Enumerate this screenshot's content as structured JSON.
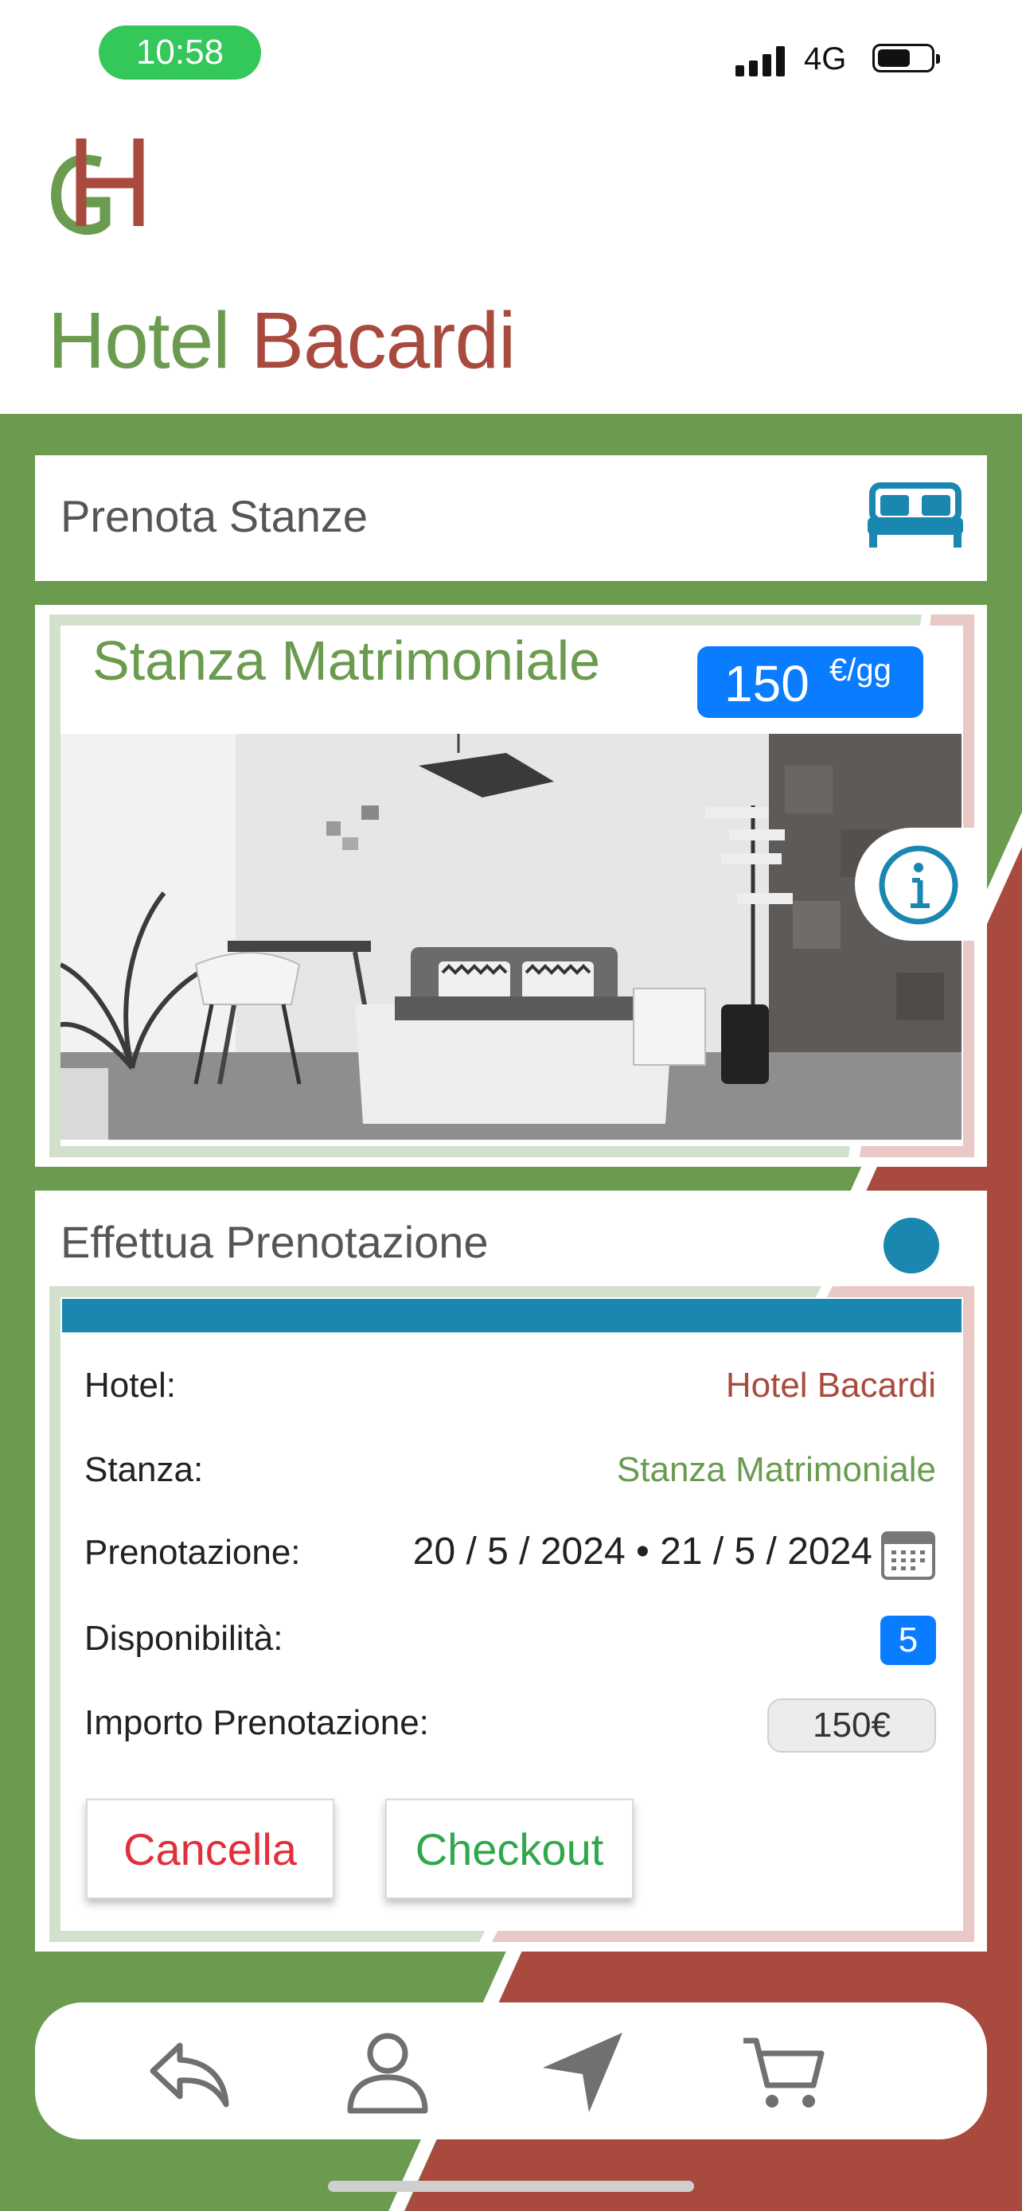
{
  "status_bar": {
    "time": "10:58",
    "network": "4G"
  },
  "header": {
    "logo_letters": "GH",
    "title_part1": "Hotel",
    "title_part2": "Bacardi"
  },
  "rooms_section": {
    "title": "Prenota Stanze",
    "icon": "bed-icon"
  },
  "room": {
    "name": "Stanza Matrimoniale",
    "price": "150",
    "price_unit": "€/gg",
    "info_icon": "info-icon"
  },
  "booking": {
    "title": "Effettua Prenotazione",
    "rows": {
      "hotel_label": "Hotel:",
      "hotel_value": "Hotel Bacardi",
      "room_label": "Stanza:",
      "room_value": "Stanza Matrimoniale",
      "dates_label": "Prenotazione:",
      "dates_value": "20 / 5 / 2024 • 21 / 5 / 2024",
      "availability_label": "Disponibilità:",
      "availability_value": "5",
      "amount_label": "Importo Prenotazione:",
      "amount_value": "150€"
    },
    "cancel_label": "Cancella",
    "checkout_label": "Checkout"
  },
  "bottom_nav": {
    "items": [
      "reply-icon",
      "user-icon",
      "navigation-icon",
      "cart-icon"
    ]
  },
  "colors": {
    "green": "#6a9b4e",
    "red": "#a84a3e",
    "blue": "#1a87b0",
    "accent_blue": "#0a7cff"
  }
}
